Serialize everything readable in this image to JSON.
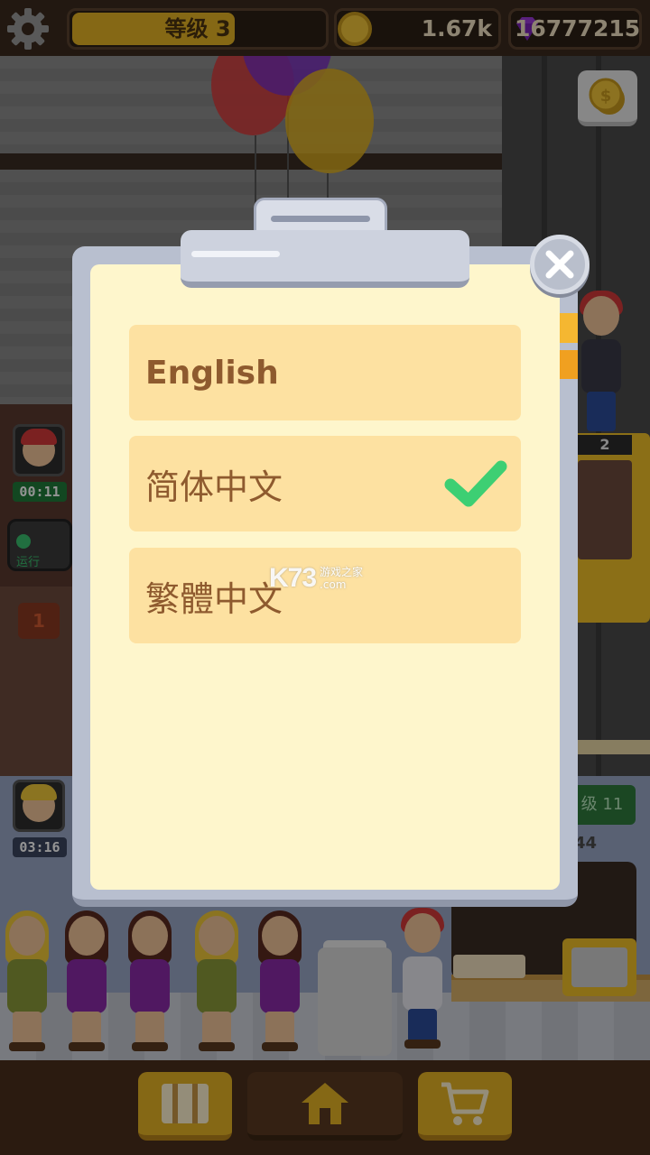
{
  "hud": {
    "level_label": "等级 3",
    "coins": "1.67k",
    "gems": "16777215"
  },
  "scene": {
    "timer_1": "00:11",
    "timer_2": "03:16",
    "run_label": "运行",
    "floor_number": "1",
    "level_chip": "级 11",
    "level_count": "44",
    "elevator_floor": "2"
  },
  "dialog": {
    "options": [
      {
        "label": "English",
        "selected": false
      },
      {
        "label": "简体中文",
        "selected": true
      },
      {
        "label": "繁體中文",
        "selected": false
      }
    ]
  },
  "watermark": {
    "main": "K73",
    "sub1": "游戏之家",
    "sub2": ".com"
  },
  "colors": {
    "paper": "#fef6cc",
    "option_bg": "#fde1a1",
    "option_text": "#8e5a2e",
    "check_green": "#3dcf73",
    "frame": "#b8bfcf"
  },
  "icons": [
    "gear-icon",
    "coin-icon",
    "gem-icon",
    "close-icon",
    "checkmark-icon",
    "map-icon",
    "home-icon",
    "cart-icon"
  ]
}
